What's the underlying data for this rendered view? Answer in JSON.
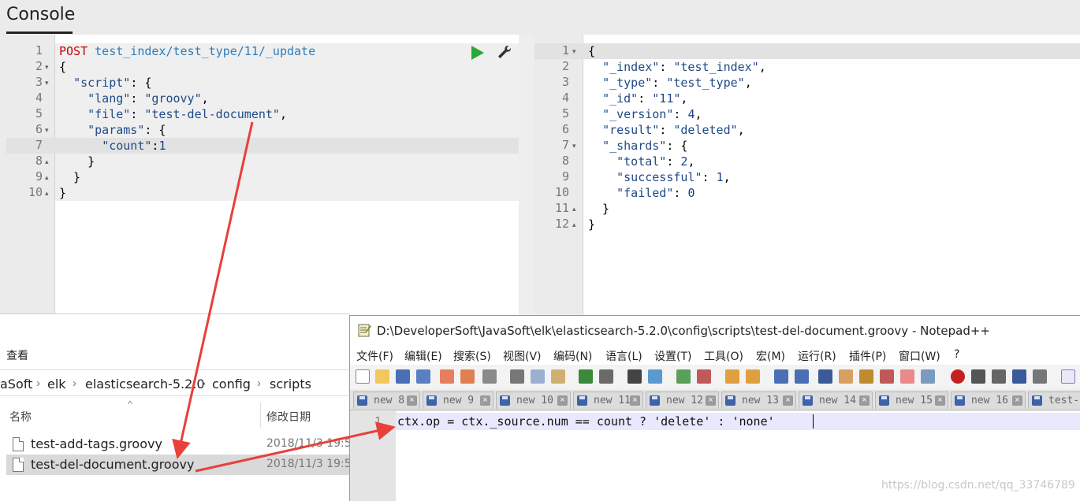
{
  "console": {
    "title": "Console"
  },
  "request": {
    "line_numbers": [
      "1",
      "2",
      "3",
      "4",
      "5",
      "6",
      "7",
      "8",
      "9",
      "10"
    ],
    "method": "POST",
    "url": "test_index/test_type/11/_update",
    "lines": [
      {
        "text": "{"
      },
      {
        "text": "  \"script\": {"
      },
      {
        "text": "    \"lang\": \"groovy\","
      },
      {
        "text": "    \"file\": \"test-del-document\","
      },
      {
        "text": "    \"params\": {"
      },
      {
        "text": "      \"count\":1"
      },
      {
        "text": "    }"
      },
      {
        "text": "  }"
      },
      {
        "text": "}"
      }
    ]
  },
  "response": {
    "line_numbers": [
      "1",
      "2",
      "3",
      "4",
      "5",
      "6",
      "7",
      "8",
      "9",
      "10",
      "11",
      "12"
    ],
    "lines": [
      {
        "text": "{"
      },
      {
        "text": "  \"_index\": \"test_index\","
      },
      {
        "text": "  \"_type\": \"test_type\","
      },
      {
        "text": "  \"_id\": \"11\","
      },
      {
        "text": "  \"_version\": 4,"
      },
      {
        "text": "  \"result\": \"deleted\","
      },
      {
        "text": "  \"_shards\": {"
      },
      {
        "text": "    \"total\": 2,"
      },
      {
        "text": "    \"successful\": 1,"
      },
      {
        "text": "    \"failed\": 0"
      },
      {
        "text": "  }"
      },
      {
        "text": "}"
      }
    ]
  },
  "explorer": {
    "view_label": "查看",
    "breadcrumb": [
      "aSoft",
      "elk",
      "elasticsearch-5.2.0",
      "config",
      "scripts"
    ],
    "col_name": "名称",
    "col_date": "修改日期",
    "files": [
      {
        "name": "test-add-tags.groovy",
        "date": "2018/11/3 19:5",
        "selected": false
      },
      {
        "name": "test-del-document.groovy",
        "date": "2018/11/3 19:5",
        "selected": true
      }
    ]
  },
  "notepad": {
    "title": "D:\\DeveloperSoft\\JavaSoft\\elk\\elasticsearch-5.2.0\\config\\scripts\\test-del-document.groovy - Notepad++",
    "menu": [
      "文件(F)",
      "编辑(E)",
      "搜索(S)",
      "视图(V)",
      "编码(N)",
      "语言(L)",
      "设置(T)",
      "工具(O)",
      "宏(M)",
      "运行(R)",
      "插件(P)",
      "窗口(W)",
      "?"
    ],
    "tabs": [
      "new 8",
      "new 9",
      "new 10",
      "new 11",
      "new 12",
      "new 13",
      "new 14",
      "new 15",
      "new 16",
      "test-"
    ],
    "line_number": "1",
    "code": "ctx.op = ctx._source.num == count ? 'delete' : 'none'"
  },
  "watermark": "https://blog.csdn.net/qq_33746789",
  "colors": {
    "arrow": "#e8403a",
    "play": "#2aa838",
    "method": "#c5060b",
    "url": "#2d7dbc"
  }
}
